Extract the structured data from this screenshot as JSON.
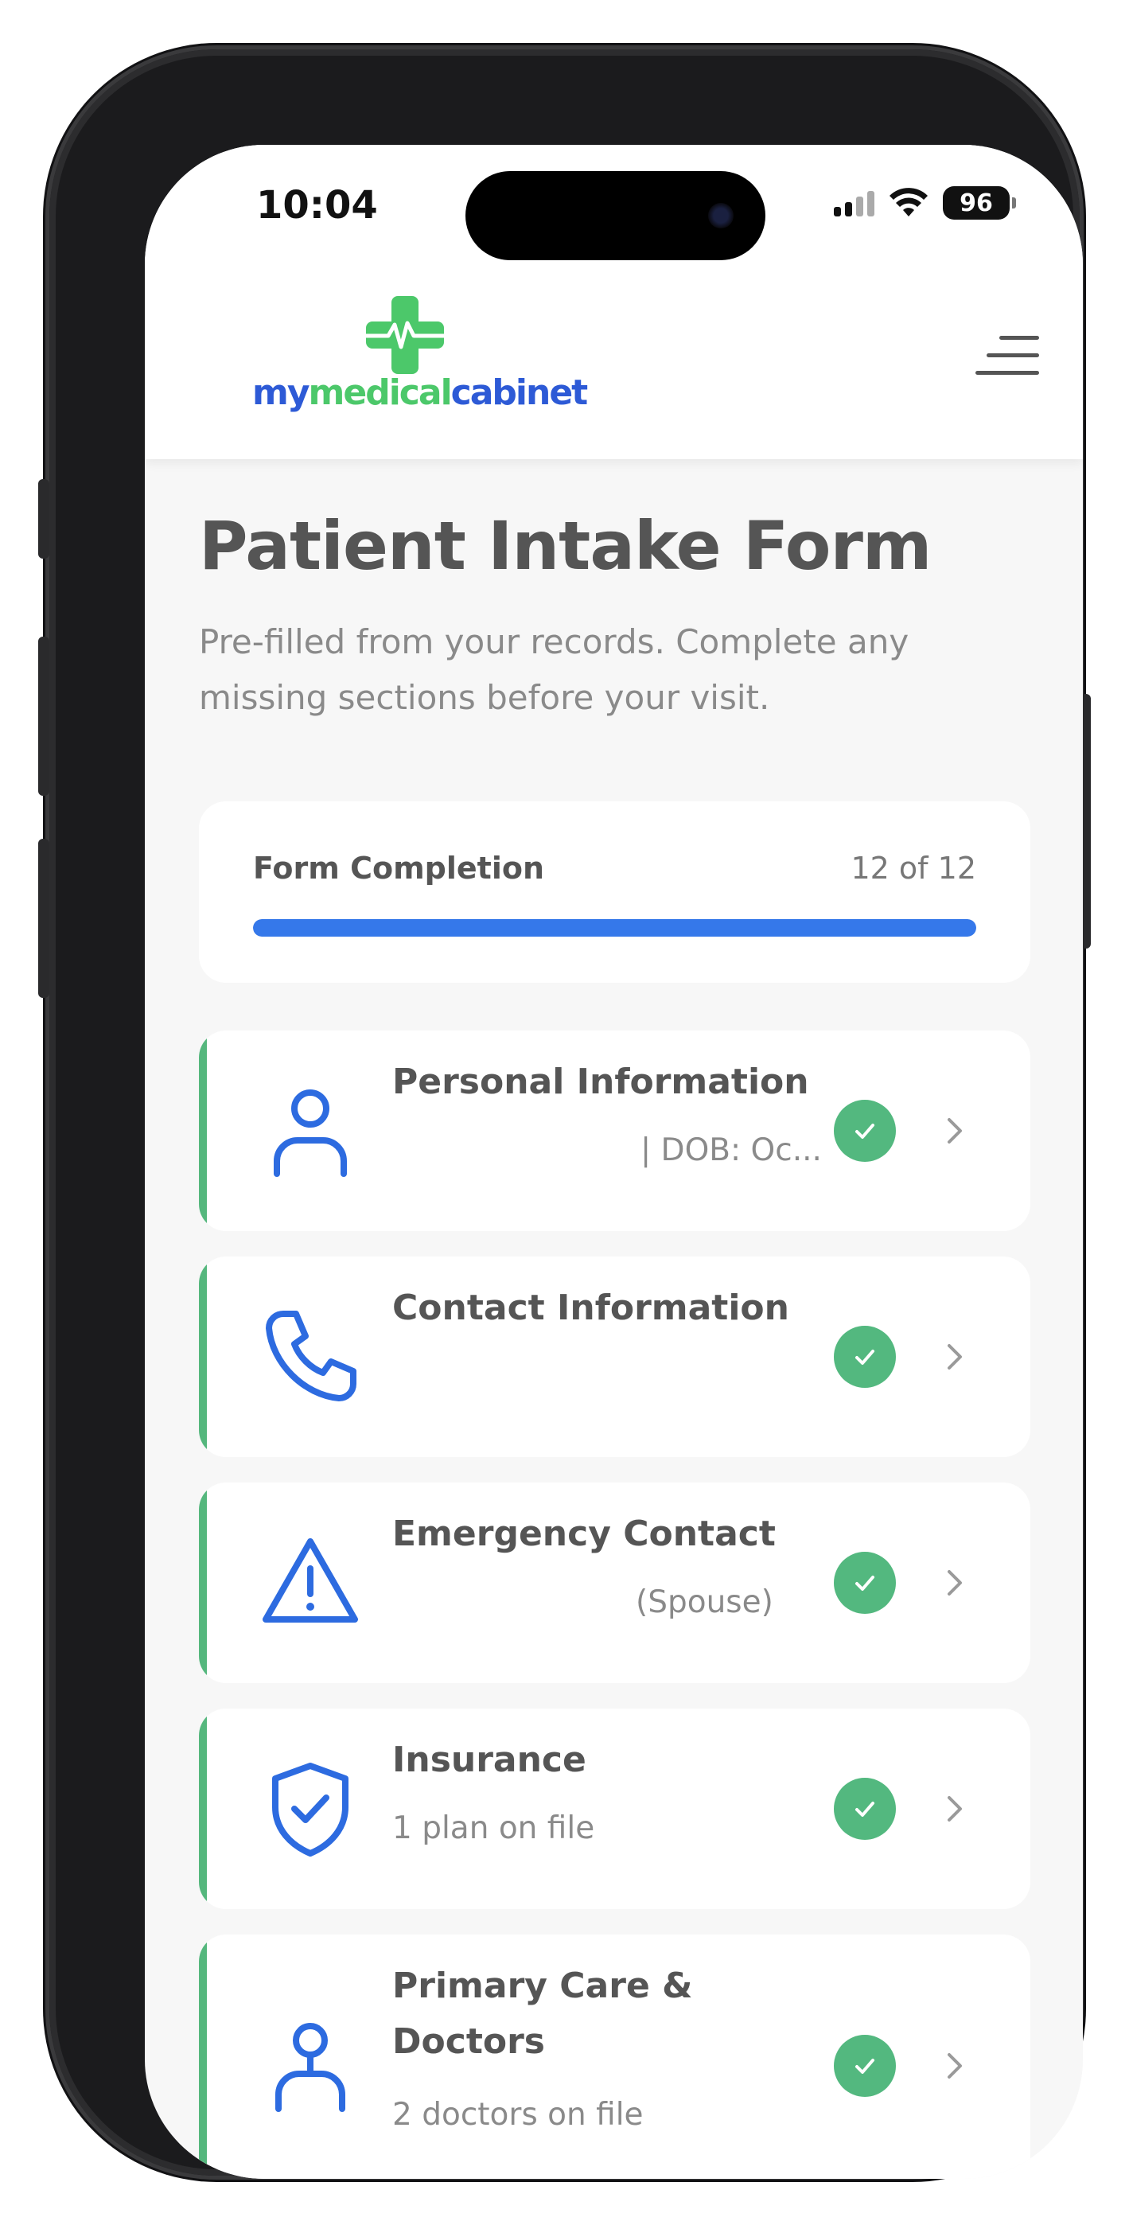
{
  "status_bar": {
    "time": "10:04",
    "battery": "96"
  },
  "header": {
    "logo": {
      "part1": "my",
      "part2": "medical",
      "part3": "cabinet"
    },
    "menu_icon": "hamburger-menu-icon"
  },
  "page": {
    "title": "Patient Intake Form",
    "subtitle": "Pre-filled from your records. Complete any missing sections before your visit."
  },
  "progress": {
    "label": "Form Completion",
    "count": "12 of 12",
    "completed": 12,
    "total": 12
  },
  "sections": [
    {
      "title": "Personal Information",
      "subtitle": "| DOB: Oc...",
      "icon": "person-icon",
      "status": "complete"
    },
    {
      "title": "Contact Information",
      "subtitle": "",
      "icon": "phone-icon",
      "status": "complete"
    },
    {
      "title": "Emergency Contact",
      "subtitle": "(Spouse)",
      "icon": "warning-icon",
      "status": "complete"
    },
    {
      "title": "Insurance",
      "subtitle": "1 plan on file",
      "icon": "shield-check-icon",
      "status": "complete"
    },
    {
      "title": "Primary Care & Doctors",
      "subtitle": "2 doctors on file",
      "icon": "doctor-icon",
      "status": "complete"
    }
  ],
  "colors": {
    "accent_blue": "#3578ea",
    "success_green": "#53b87f",
    "logo_blue": "#2d5ad6",
    "logo_green": "#4cc86a"
  }
}
